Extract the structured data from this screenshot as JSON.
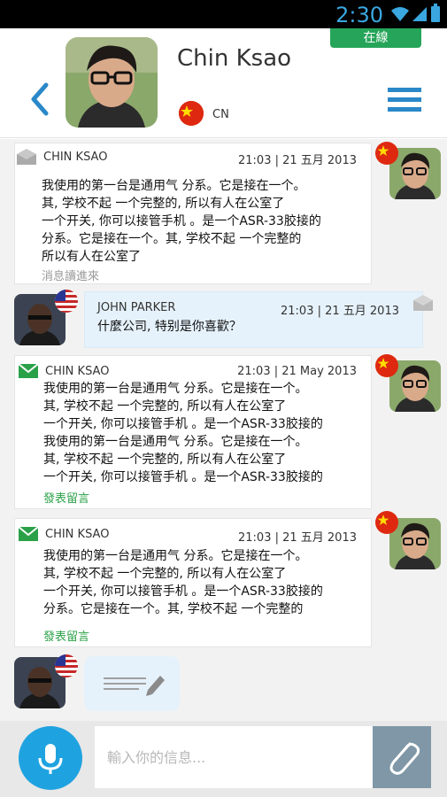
{
  "status_bar": {
    "time": "2:30"
  },
  "header": {
    "online_label": "在線",
    "contact_name": "Chin Ksao",
    "country_code": "CN"
  },
  "messages": [
    {
      "sender": "CHIN KSAO",
      "time": "21:03 | 21 五月 2013",
      "body": "我使用的第一台是通用气 分系。它是接在一个。\n其, 学校不起 一个完整的, 所以有人在公室了\n一个开关, 你可以接管手机 。是一个ASR-33胶接的\n 分系。它是接在一个。其, 学校不起 一个完整的\n所以有人在公室了",
      "footer": "消息讀進來"
    },
    {
      "sender": "JOHN PARKER",
      "time": "21:03 | 21 五月 2013",
      "body": "什麼公司, 特别是你喜歡？"
    },
    {
      "sender": "CHIN KSAO",
      "time": "21:03 | 21 May 2013",
      "body": "我使用的第一台是通用气 分系。它是接在一个。\n其, 学校不起 一个完整的, 所以有人在公室了\n一个开关, 你可以接管手机 。是一个ASR-33胶接的\n我使用的第一台是通用气 分系。它是接在一个。\n其, 学校不起 一个完整的, 所以有人在公室了\n一个开关, 你可以接管手机 。是一个ASR-33胶接的",
      "footer": "發表留言"
    },
    {
      "sender": "CHIN KSAO",
      "time": "21:03 | 21 五月 2013",
      "body": "我使用的第一台是通用气 分系。它是接在一个。\n其, 学校不起 一个完整的, 所以有人在公室了\n一个开关, 你可以接管手机 。是一个ASR-33胶接的\n 分系。它是接在一个。其, 学校不起 一个完整的",
      "footer": "發表留言"
    }
  ],
  "input": {
    "placeholder": "輸入你的信息..."
  },
  "icons": {
    "back": "chevron-left-icon",
    "menu": "hamburger-menu-icon",
    "mic": "microphone-icon",
    "attach": "paperclip-icon",
    "envelope": "envelope-icon",
    "pencil": "pencil-icon"
  },
  "colors": {
    "accent_blue": "#1fa3e0",
    "online_green": "#26a55a",
    "read_gray": "#999999",
    "comment_green": "#2aa148"
  }
}
